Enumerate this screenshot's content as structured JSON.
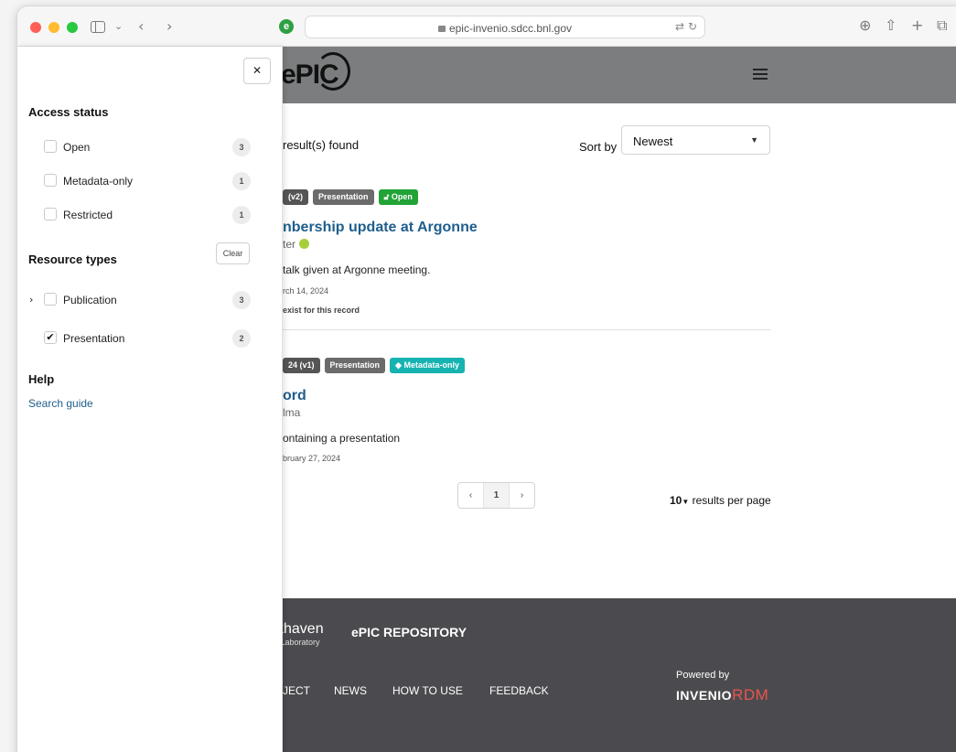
{
  "browser": {
    "url": "epic-invenio.sdcc.bnl.gov",
    "nav_back": "‹",
    "nav_forward": "›"
  },
  "header": {
    "logo": "ePIC"
  },
  "results": {
    "count_text": "result(s) found",
    "sort_label": "Sort by",
    "sort_value": "Newest",
    "records": [
      {
        "version": "(v2)",
        "type": "Presentation",
        "access": "Open",
        "title": "nbership update at Argonne",
        "creator": "ter",
        "description": "talk given at Argonne meeting.",
        "date": "rch 14, 2024",
        "note": "exist for this record"
      },
      {
        "version": "24 (v1)",
        "type": "Presentation",
        "access": "Metadata-only",
        "title": "ord",
        "creator": "lma",
        "description": "ontaining a presentation",
        "date": "bruary 27, 2024"
      }
    ],
    "pagination": {
      "prev": "‹",
      "current": "1",
      "next": "›"
    },
    "per_page_value": "10",
    "per_page_label": "results per page"
  },
  "footer": {
    "lab_name": "khaven",
    "lab_sub": "l Laboratory",
    "repo_name": "ePIC REPOSITORY",
    "links": [
      "JECT",
      "NEWS",
      "HOW TO USE",
      "FEEDBACK"
    ],
    "powered_by": "Powered by",
    "invenio": "INVENIO",
    "rdm": "RDM"
  },
  "facets": {
    "close": "✕",
    "access_heading": "Access status",
    "access_items": [
      {
        "label": "Open",
        "count": "3",
        "checked": false
      },
      {
        "label": "Metadata-only",
        "count": "1",
        "checked": false
      },
      {
        "label": "Restricted",
        "count": "1",
        "checked": false
      }
    ],
    "resource_heading": "Resource types",
    "clear_label": "Clear",
    "resource_items": [
      {
        "label": "Publication",
        "count": "3",
        "checked": false
      },
      {
        "label": "Presentation",
        "count": "2",
        "checked": true
      }
    ],
    "help_heading": "Help",
    "search_guide": "Search guide"
  },
  "colors": {
    "header_bg": "#7b7d7f",
    "link": "#1f5e8c",
    "open_label": "#21a336",
    "metadata_label": "#16b3b1",
    "footer_bg": "#4b4b4f"
  }
}
